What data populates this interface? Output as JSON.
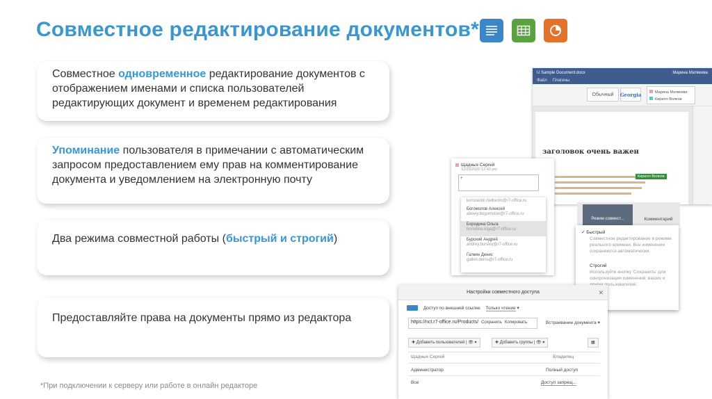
{
  "title": "Совместное редактирование документов*",
  "app_icons": {
    "document": {
      "icon": "document-lines-icon",
      "color": "#3d86c6"
    },
    "spreadsheet": {
      "icon": "table-grid-icon",
      "color": "#5aa23e"
    },
    "presentation": {
      "icon": "pie-chart-icon",
      "color": "#e4722b"
    }
  },
  "cards": [
    {
      "pre": "Совместное ",
      "hl": "одновременное",
      "post": " редактирование документов с отображением именами и списка пользователей редактирующих документ и временем редактирования"
    },
    {
      "pre": "",
      "hl": "Упоминание",
      "post": " пользователя в примечании с автоматическим запросом предоставлением ему прав на комментирование документа и уведомлением на электронную почту"
    },
    {
      "pre": "Два режима совместной работы (",
      "hl": "быстрый и строгий",
      "post": ")"
    },
    {
      "pre": "Предоставляйте права на документы прямо из редактора",
      "hl": "",
      "post": ""
    }
  ],
  "footnote": "*При подключении к серверу или работе в онлайн редакторе",
  "editor": {
    "file_name": "U Sample Document.docx",
    "user": "Марина Матвеева",
    "menu": [
      "Файл",
      "Плагины"
    ],
    "style_normal": "Обычный",
    "style_font": "Georgia",
    "active_users": [
      {
        "name": "Марина Матвеева",
        "color": "#e7a1b7"
      },
      {
        "name": "Кирилл Волков",
        "color": "#5bc8c2"
      }
    ],
    "heading": "заголовок очень важен",
    "user_tag": "Кирилл Волков",
    "mode_button": "Режим совмест...",
    "comments_button": "Комментарий",
    "mode_options": [
      {
        "label": "✓ Быстрый",
        "desc": "Совместное редактирование в режиме реального времени. Все изменения сохраняются автоматически."
      },
      {
        "label": "Строгий",
        "desc": "Используйте кнопку 'Сохранить' для синхронизации изменений, ваших и других пользователей."
      }
    ]
  },
  "comment": {
    "author": "Щадных Сергей",
    "date": "12/26/2020 12:43 pm",
    "input": "+",
    "mentions": [
      {
        "name": "",
        "email": "konstantin.belbenin@r7-office.ru"
      },
      {
        "name": "Богомолов Алексей",
        "email": "alexey.bogomolov@r7-office.ru"
      },
      {
        "name": "Бородина Ольга",
        "email": "borodina.olga@r7-office.ru"
      },
      {
        "name": "Бурский Андрей",
        "email": "andrey.burskiy@r7-office.ru"
      },
      {
        "name": "Галкин Денис",
        "email": "galkin.denis@r7-office.ru"
      }
    ]
  },
  "share": {
    "title": "Настройки совместного доступа",
    "external_link_label": "Доступ по внешней ссылке",
    "external_access": "Только чтение",
    "link": "https://nct.r7-office.ru/Products/",
    "save_label": "Сохранить",
    "copy_label": "Копировать",
    "embed_label": "Встраивание документа",
    "add_users": "Добавить пользователей",
    "add_groups": "Добавить группы",
    "rows": [
      {
        "name": "Щадных Сергей",
        "access": "Владелец"
      },
      {
        "name": "Администратор",
        "access": "Полный доступ"
      },
      {
        "name": "Все",
        "access": "Доступ запрещ..."
      }
    ]
  }
}
